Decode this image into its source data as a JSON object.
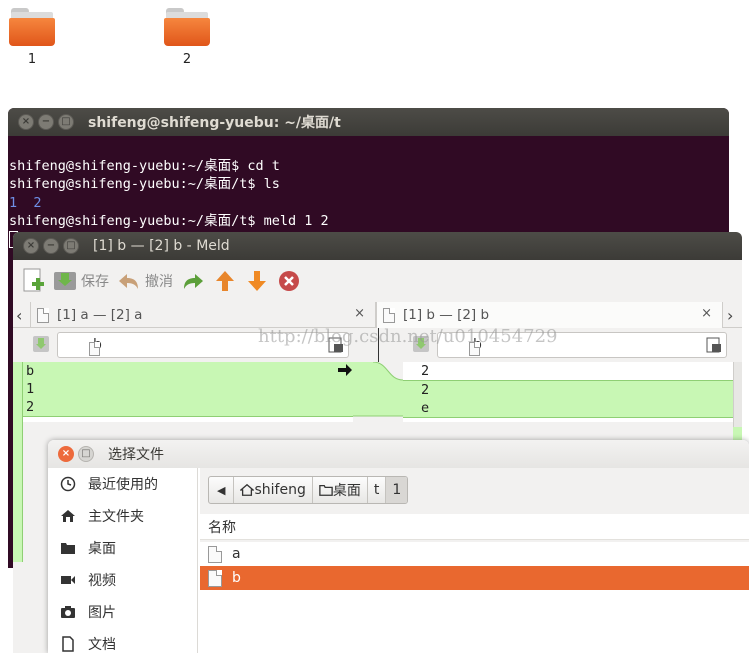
{
  "desktop": {
    "folders": [
      {
        "label": "1"
      },
      {
        "label": "2"
      }
    ]
  },
  "terminal": {
    "title": "shifeng@shifeng-yuebu: ~/桌面/t",
    "lines": [
      "shifeng@shifeng-yuebu:~/桌面$ cd t",
      "shifeng@shifeng-yuebu:~/桌面/t$ ls",
      "1  2",
      "shifeng@shifeng-yuebu:~/桌面/t$ meld 1 2"
    ]
  },
  "meld": {
    "title": "[1] b — [2] b - Meld",
    "toolbar": {
      "save_label": "保存",
      "undo_label": "撤消"
    },
    "tabs": [
      {
        "label": "[1] a — [2] a"
      },
      {
        "label": "[1] b — [2] b"
      }
    ],
    "left_path": "b",
    "right_path": "b",
    "left_lines": [
      "b",
      "1",
      "2"
    ],
    "right_lines": [
      "2",
      "2",
      "e"
    ],
    "watermark": "http://blog.csdn.net/u010454729"
  },
  "chooser": {
    "title": "选择文件",
    "sidebar": [
      {
        "label": "最近使用的",
        "icon": "clock-icon"
      },
      {
        "label": "主文件夹",
        "icon": "home-icon"
      },
      {
        "label": "桌面",
        "icon": "folder-icon"
      },
      {
        "label": "视频",
        "icon": "video-icon"
      },
      {
        "label": "图片",
        "icon": "camera-icon"
      },
      {
        "label": "文档",
        "icon": "document-icon"
      }
    ],
    "breadcrumbs": [
      "shifeng",
      "桌面",
      "t",
      "1"
    ],
    "column_name": "名称",
    "files": [
      {
        "name": "a",
        "selected": false
      },
      {
        "name": "b",
        "selected": true
      }
    ],
    "selection_color": "#e9682f"
  }
}
